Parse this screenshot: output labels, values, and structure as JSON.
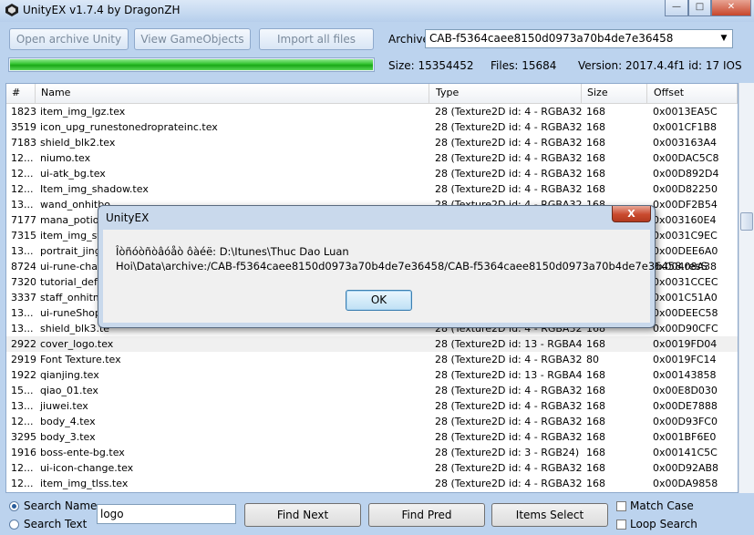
{
  "window": {
    "title": "UnityEX v1.7.4 by DragonZH",
    "minimize": "—",
    "maximize": "□",
    "close": "✕"
  },
  "toolbar": {
    "open_archive": "Open archive Unity",
    "view_gameobjects": "View GameObjects",
    "import_all": "Import all files",
    "archive_label": "Archive",
    "archive_value": "CAB-f5364caee8150d0973a70b4de7e36458",
    "progress_fraction": 1.0
  },
  "info": {
    "size": "Size: 15354452",
    "files": "Files: 15684",
    "version": "Version: 2017.4.4f1 id: 17 IOS"
  },
  "table": {
    "columns": [
      "#",
      "Name",
      "Type",
      "Size",
      "Offset"
    ],
    "rows": [
      [
        "1823",
        "item_img_lgz.tex",
        "28 (Texture2D id: 4 - RGBA32)",
        "168",
        "0x0013EA5C"
      ],
      [
        "3519",
        "icon_upg_runestonedroprateinc.tex",
        "28 (Texture2D id: 4 - RGBA32)",
        "168",
        "0x001CF1B8"
      ],
      [
        "7183",
        "shield_blk2.tex",
        "28 (Texture2D id: 4 - RGBA32)",
        "168",
        "0x003163A4"
      ],
      [
        "12...",
        "niumo.tex",
        "28 (Texture2D id: 4 - RGBA32)",
        "168",
        "0x00DAC5C8"
      ],
      [
        "12...",
        "ui-atk_bg.tex",
        "28 (Texture2D id: 4 - RGBA32)",
        "168",
        "0x00D892D4"
      ],
      [
        "12...",
        "Item_img_shadow.tex",
        "28 (Texture2D id: 4 - RGBA32)",
        "168",
        "0x00D82250"
      ],
      [
        "13...",
        "wand_onhitbo",
        "28 (Texture2D id: 4 - RGBA32)",
        "168",
        "0x00DF2B54"
      ],
      [
        "7177",
        "mana_potion",
        "28 (Texture2D id: 4 - RGBA32)",
        "168",
        "0x003160E4"
      ],
      [
        "7315",
        "item_img_syb",
        "28 (Texture2D id: 4 - RGBA32)",
        "168",
        "0x0031C9EC"
      ],
      [
        "13...",
        "portrait_jingw",
        "28 (Texture2D id: 4 - RGBA32)",
        "168",
        "0x00DEE6A0"
      ],
      [
        "8724",
        "ui-rune-chass",
        "28 (Texture2D id: 4 - RGBA32)",
        "168",
        "0x00408A38"
      ],
      [
        "7320",
        "tutorial_defen",
        "28 (Texture2D id: 4 - RGBA32)",
        "168",
        "0x0031CCEC"
      ],
      [
        "3337",
        "staff_onhitmp",
        "28 (Texture2D id: 4 - RGBA32)",
        "168",
        "0x001C51A0"
      ],
      [
        "13...",
        "ui-runeShop-l",
        "28 (Texture2D id: 4 - RGBA32)",
        "168",
        "0x00DEEC58"
      ],
      [
        "13...",
        "shield_blk3.te",
        "28 (Texture2D id: 4 - RGBA32)",
        "168",
        "0x00D90CFC"
      ],
      [
        "2922",
        "cover_logo.tex",
        "28 (Texture2D id: 13 - RGBA4...",
        "168",
        "0x0019FD04"
      ],
      [
        "2919",
        "Font Texture.tex",
        "28 (Texture2D id: 4 - RGBA32)",
        "80",
        "0x0019FC14"
      ],
      [
        "1922",
        "qianjing.tex",
        "28 (Texture2D id: 13 - RGBA4...",
        "168",
        "0x00143858"
      ],
      [
        "15...",
        "qiao_01.tex",
        "28 (Texture2D id: 4 - RGBA32)",
        "168",
        "0x00E8D030"
      ],
      [
        "13...",
        "jiuwei.tex",
        "28 (Texture2D id: 4 - RGBA32)",
        "168",
        "0x00DE7888"
      ],
      [
        "12...",
        "body_4.tex",
        "28 (Texture2D id: 4 - RGBA32)",
        "168",
        "0x00D93FC0"
      ],
      [
        "3295",
        "body_3.tex",
        "28 (Texture2D id: 4 - RGBA32)",
        "168",
        "0x001BF6E0"
      ],
      [
        "1916",
        "boss-ente-bg.tex",
        "28 (Texture2D id: 3 - RGB24)",
        "168",
        "0x00141C5C"
      ],
      [
        "12...",
        "ui-icon-change.tex",
        "28 (Texture2D id: 4 - RGBA32)",
        "168",
        "0x00D92AB8"
      ],
      [
        "12...",
        "item_img_tlss.tex",
        "28 (Texture2D id: 4 - RGBA32)",
        "168",
        "0x00DA9858"
      ]
    ]
  },
  "search": {
    "search_name": "Search Name",
    "search_text": "Search Text",
    "query": "logo",
    "find_next": "Find Next",
    "find_pred": "Find Pred",
    "items_select": "Items Select",
    "match_case": "Match Case",
    "loop_search": "Loop Search"
  },
  "dialog": {
    "title": "UnityEX",
    "close": "X",
    "message_line1": "Îòñóòñòâóåò ôàéë: D:\\Itunes\\Thuc Dao Luan",
    "message_line2": "Hoi\\Data\\archive:/CAB-f5364caee8150d0973a70b4de7e36458/CAB-f5364caee8150d0973a70b4de7e36458.resS",
    "ok": "OK"
  },
  "colors": {
    "progress_green": "#2fc12c",
    "window_bg": "#bcd3ee",
    "dialog_close": "#c94a2e"
  }
}
